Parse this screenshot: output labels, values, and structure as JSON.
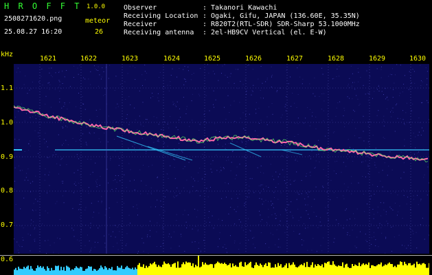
{
  "header": {
    "logo": "H R O F F T",
    "version": "1.0.0",
    "filename": "2508271620.png",
    "datetime": "25.08.27 16:20",
    "meteor_label": "meteor",
    "meteor_count": "26",
    "fields": [
      {
        "label": "Observer",
        "value": ": Takanori Kawachi"
      },
      {
        "label": "Receiving Location",
        "value": ": Ogaki, Gifu, JAPAN (136.60E, 35.35N)"
      },
      {
        "label": "Receiver",
        "value": ": R820T2(RTL-SDR) SDR-Sharp 53.1000MHz"
      },
      {
        "label": "Receiving antenna",
        "value": ": 2el-HB9CV Vertical (el. E-W)"
      }
    ]
  },
  "plot": {
    "y_unit": "kHz",
    "x_ticks": [
      "1621",
      "1622",
      "1623",
      "1624",
      "1625",
      "1626",
      "1627",
      "1628",
      "1629",
      "1630"
    ],
    "y_ticks": [
      "1.1",
      "1.0",
      "0.9",
      "0.8",
      "0.7",
      "0.6"
    ],
    "background_color": "#0b0b55",
    "trace_color": "#ff66aa",
    "carrier_color": "#33ccff",
    "histogram_color": "#ffff00",
    "histogram_left_color": "#33ccff"
  }
}
